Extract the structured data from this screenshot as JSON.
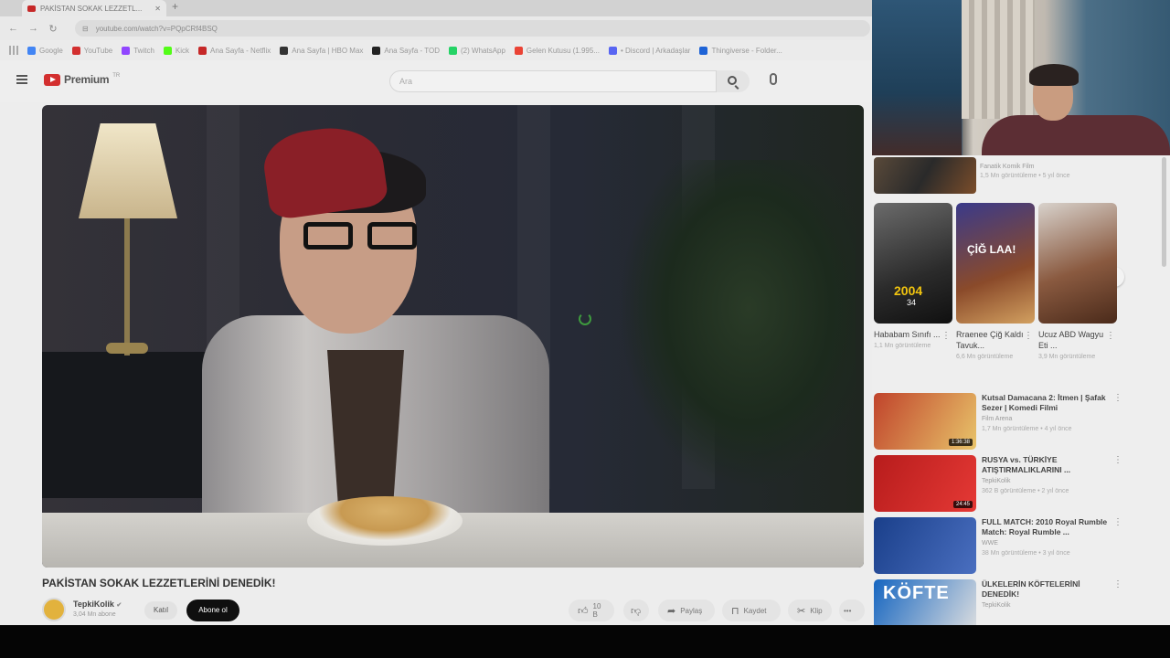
{
  "browser": {
    "tab_title": "PAKİSTAN SOKAK LEZZETL...",
    "url": "youtube.com/watch?v=PQpCRf4BSQ",
    "bookmarks": [
      {
        "label": "Google",
        "color": "#4285f4"
      },
      {
        "label": "YouTube",
        "color": "#d32f2f"
      },
      {
        "label": "Twitch",
        "color": "#9146ff"
      },
      {
        "label": "Kick",
        "color": "#53fc18"
      },
      {
        "label": "Ana Sayfa - Netflix",
        "color": "#c62828"
      },
      {
        "label": "Ana Sayfa | HBO Max",
        "color": "#333333"
      },
      {
        "label": "Ana Sayfa - TOD",
        "color": "#222222"
      },
      {
        "label": "(2) WhatsApp",
        "color": "#25d366"
      },
      {
        "label": "Gelen Kutusu (1.995...",
        "color": "#ea4335"
      },
      {
        "label": "• Discord | Arkadaşlar",
        "color": "#5865f2"
      },
      {
        "label": "Thingiverse - Folder...",
        "color": "#1e63d6"
      }
    ]
  },
  "youtube": {
    "logo_text": "Premium",
    "logo_sup": "TR",
    "search_placeholder": "Ara"
  },
  "video": {
    "title": "PAKİSTAN SOKAK LEZZETLERİNİ DENEDİK!",
    "channel": "TepkiKolik",
    "verified": "✔",
    "subscribers": "3,04 Mn abone",
    "join_label": "Katıl",
    "subscribe_label": "Abone ol",
    "likes": "10 B",
    "share_label": "Paylaş",
    "save_label": "Kaydet",
    "clip_label": "Klip",
    "more_label": "•••"
  },
  "sidebar": {
    "top_item": {
      "channel": "Fanatik Komik Film",
      "meta": "1,5 Mn görüntüleme • 5 yıl önce"
    },
    "shorts": [
      {
        "title": "Hababam Sınıfı ...",
        "views": "1,1 Mn görüntüleme",
        "overlay": "2004",
        "overlay_sub": "34"
      },
      {
        "title": "Rraenee Çiğ Kaldı Tavuk...",
        "views": "6,6 Mn görüntüleme",
        "overlay": "ÇİĞ LAA!",
        "overlay_sub": ""
      },
      {
        "title": "Ucuz ABD Wagyu Eti ...",
        "views": "3,9 Mn görüntüleme",
        "overlay": "",
        "overlay_sub": ""
      }
    ],
    "recommendations": [
      {
        "title": "Kutsal Damacana 2: İtmen | Şafak Sezer | Komedi Filmi",
        "channel": "Film Arena",
        "meta": "1,7 Mn görüntüleme • 4 yıl önce",
        "duration": "1:36:38",
        "color1": "#c0432b",
        "color2": "#e8c46a"
      },
      {
        "title": "RUSYA vs. TÜRKİYE ATIŞTIRMALIKLARINI ...",
        "channel": "TepkiKolik",
        "meta": "362 B görüntüleme • 2 yıl önce",
        "duration": "24:45",
        "color1": "#b71c1c",
        "color2": "#e53935"
      },
      {
        "title": "FULL MATCH: 2010 Royal Rumble Match: Royal Rumble ...",
        "channel": "WWE",
        "meta": "38 Mn görüntüleme • 3 yıl önce",
        "duration": "",
        "color1": "#1a3f8a",
        "color2": "#4a6fc0"
      },
      {
        "title": "ÜLKELERİN KÖFTELERİNİ DENEDİK!",
        "channel": "TepkiKolik",
        "meta": "",
        "duration": "",
        "color1": "#1565c0",
        "color2": "#e0e0e0",
        "overlay": "KÖFTE"
      }
    ]
  }
}
